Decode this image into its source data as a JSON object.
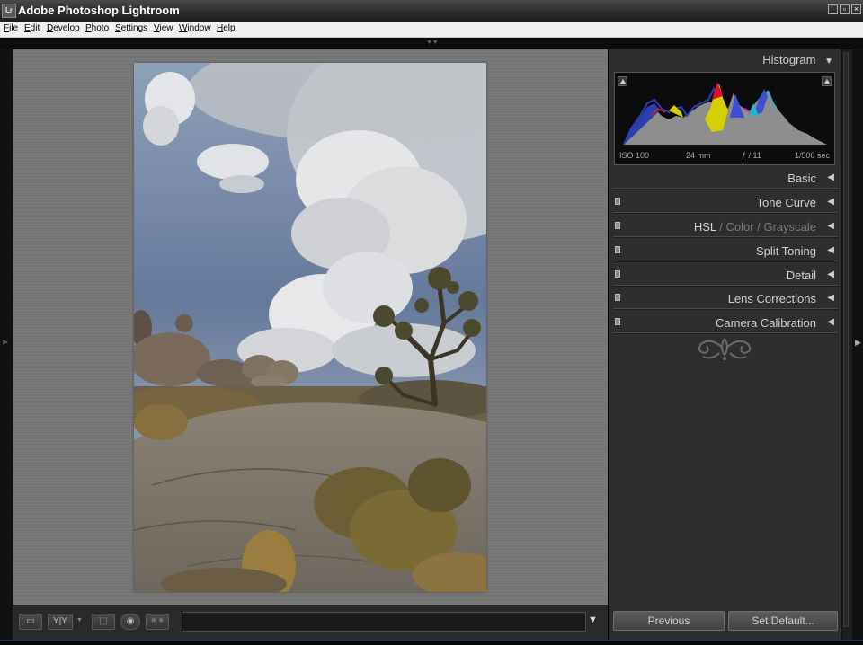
{
  "window": {
    "title": "Adobe Photoshop Lightroom",
    "app_icon_text": "Lr",
    "icon": "lightroom-app-icon"
  },
  "menu": [
    "File",
    "Edit",
    "Develop",
    "Photo",
    "Settings",
    "View",
    "Window",
    "Help"
  ],
  "histogram": {
    "title": "Histogram",
    "iso": "ISO 100",
    "focal_length": "24 mm",
    "aperture": "ƒ / 11",
    "shutter": "1/500 sec"
  },
  "sections": [
    {
      "label": "Basic",
      "state": "collapsed"
    },
    {
      "label": "Tone Curve",
      "state": "collapsed",
      "toggle": true
    },
    {
      "label_parts": [
        "HSL",
        "Color",
        "Grayscale"
      ],
      "separator": "/",
      "state": "collapsed",
      "toggle": true
    },
    {
      "label": "Split Toning",
      "state": "collapsed",
      "toggle": true
    },
    {
      "label": "Detail",
      "state": "collapsed",
      "toggle": true
    },
    {
      "label": "Lens Corrections",
      "state": "collapsed",
      "toggle": true
    },
    {
      "label": "Camera Calibration",
      "state": "collapsed",
      "toggle": true
    }
  ],
  "buttons": {
    "previous": "Previous",
    "set_default": "Set Default..."
  },
  "toolbar": {
    "view_icon": "loupe-view-icon",
    "compare_label": "Y|Y",
    "compare_icon": "before-after-icon",
    "crop_icon": "crop-overlay-icon",
    "spot_icon": "spot-removal-icon",
    "redeye_icon": "red-eye-icon"
  },
  "photo": {
    "description_icon": "desert-joshua-tree-photo"
  },
  "colors": {
    "panel_bg": "#2e2e2e",
    "canvas_bg": "#757575",
    "accent_blue": "#1e3e7a"
  }
}
